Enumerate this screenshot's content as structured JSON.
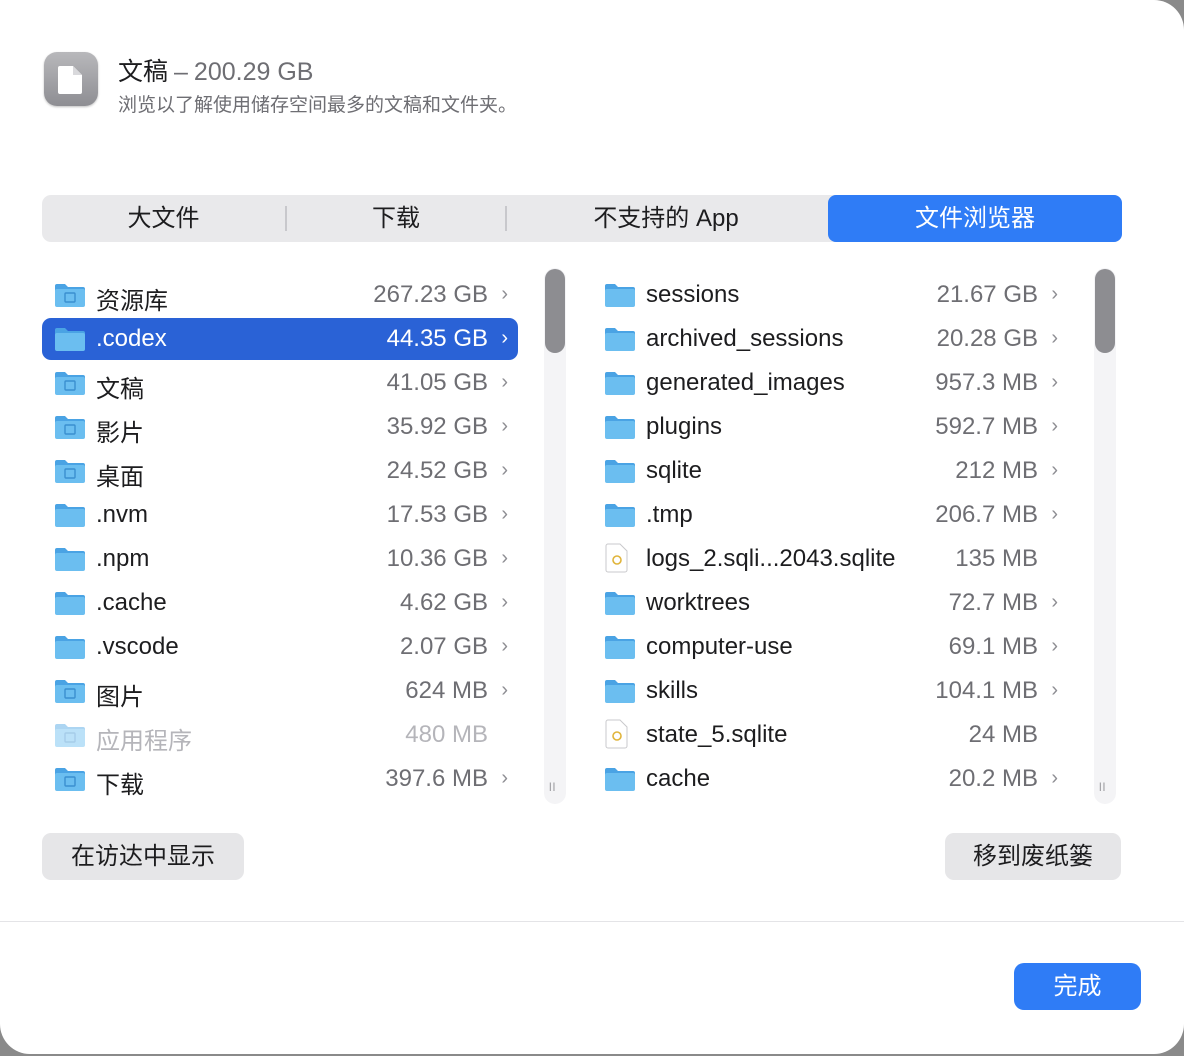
{
  "header": {
    "title": "文稿",
    "separator": "–",
    "total_size": "200.29 GB",
    "subtitle": "浏览以了解使用储存空间最多的文稿和文件夹。",
    "icon": "document-icon"
  },
  "tabs": [
    {
      "label": "大文件",
      "active": false
    },
    {
      "label": "下载",
      "active": false
    },
    {
      "label": "不支持的 App",
      "active": false
    },
    {
      "label": "文件浏览器",
      "active": true
    }
  ],
  "left_list": [
    {
      "name": "资源库",
      "size": "267.23 GB",
      "icon": "library-folder-icon",
      "chevron": true
    },
    {
      "name": ".codex",
      "size": "44.35 GB",
      "icon": "folder-icon",
      "chevron": true,
      "selected": true
    },
    {
      "name": "文稿",
      "size": "41.05 GB",
      "icon": "documents-folder-icon",
      "chevron": true
    },
    {
      "name": "影片",
      "size": "35.92 GB",
      "icon": "movies-folder-icon",
      "chevron": true
    },
    {
      "name": "桌面",
      "size": "24.52 GB",
      "icon": "desktop-folder-icon",
      "chevron": true
    },
    {
      "name": ".nvm",
      "size": "17.53 GB",
      "icon": "folder-icon",
      "chevron": true
    },
    {
      "name": ".npm",
      "size": "10.36 GB",
      "icon": "folder-icon",
      "chevron": true
    },
    {
      "name": ".cache",
      "size": "4.62 GB",
      "icon": "folder-icon",
      "chevron": true
    },
    {
      "name": ".vscode",
      "size": "2.07 GB",
      "icon": "folder-icon",
      "chevron": true
    },
    {
      "name": "图片",
      "size": "624 MB",
      "icon": "pictures-folder-icon",
      "chevron": true
    },
    {
      "name": "应用程序",
      "size": "480 MB",
      "icon": "applications-folder-icon",
      "chevron": false,
      "dim": true
    },
    {
      "name": "下载",
      "size": "397.6 MB",
      "icon": "downloads-folder-icon",
      "chevron": true
    }
  ],
  "right_list": [
    {
      "name": "sessions",
      "size": "21.67 GB",
      "icon": "folder-icon",
      "chevron": true
    },
    {
      "name": "archived_sessions",
      "size": "20.28 GB",
      "icon": "folder-icon",
      "chevron": true
    },
    {
      "name": "generated_images",
      "size": "957.3 MB",
      "icon": "folder-icon",
      "chevron": true
    },
    {
      "name": "plugins",
      "size": "592.7 MB",
      "icon": "folder-icon",
      "chevron": true
    },
    {
      "name": "sqlite",
      "size": "212 MB",
      "icon": "folder-icon",
      "chevron": true
    },
    {
      "name": ".tmp",
      "size": "206.7 MB",
      "icon": "folder-icon",
      "chevron": true
    },
    {
      "name": "logs_2.sqli...2043.sqlite",
      "size": "135 MB",
      "icon": "sqlite-file-icon",
      "chevron": false
    },
    {
      "name": "worktrees",
      "size": "72.7 MB",
      "icon": "folder-icon",
      "chevron": true
    },
    {
      "name": "computer-use",
      "size": "69.1 MB",
      "icon": "folder-icon",
      "chevron": true
    },
    {
      "name": "skills",
      "size": "104.1 MB",
      "icon": "folder-icon",
      "chevron": true
    },
    {
      "name": "state_5.sqlite",
      "size": "24 MB",
      "icon": "sqlite-file-icon",
      "chevron": false
    },
    {
      "name": "cache",
      "size": "20.2 MB",
      "icon": "folder-icon",
      "chevron": true
    }
  ],
  "buttons": {
    "show_in_finder": "在访达中显示",
    "move_to_trash": "移到废纸篓",
    "done": "完成"
  },
  "colors": {
    "accent": "#2f7cf6",
    "selection": "#2a62d6",
    "folder": "#5ab4ee"
  }
}
